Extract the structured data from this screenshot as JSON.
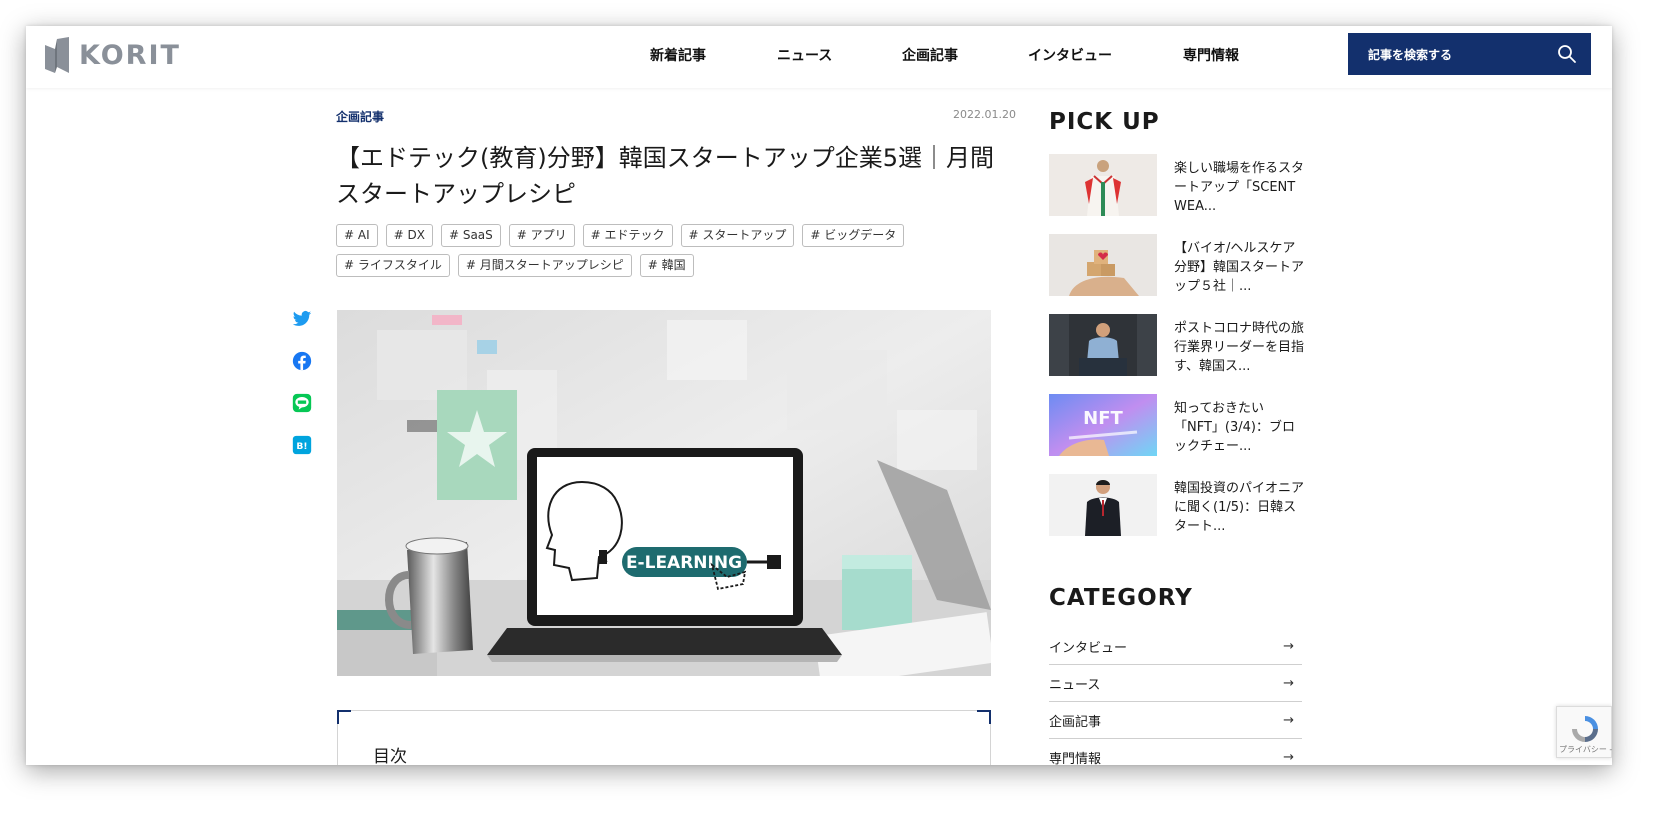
{
  "header": {
    "logo_text": "KORIT",
    "nav": [
      "新着記事",
      "ニュース",
      "企画記事",
      "インタビュー",
      "専門情報"
    ],
    "search_label": "記事を検索する"
  },
  "article": {
    "category": "企画記事",
    "date": "2022.01.20",
    "title": "【エドテック(教育)分野】韓国スタートアップ企業5選｜月間スタートアップレシピ",
    "tags": [
      "# AI",
      "# DX",
      "# SaaS",
      "# アプリ",
      "# エドテック",
      "# スタートアップ",
      "# ビッグデータ",
      "# ライフスタイル",
      "# 月間スタートアップレシピ",
      "# 韓国"
    ],
    "hero_image_text": "E-LEARNING",
    "toc_title": "目次"
  },
  "share_icons": [
    "twitter-icon",
    "facebook-icon",
    "line-icon",
    "hatena-bookmark-icon"
  ],
  "sidebar": {
    "pickup_heading": "PICK UP",
    "pickup": [
      {
        "text": "楽しい職場を作るスタートアップ「SCENT WEA..."
      },
      {
        "text": "【バイオ/ヘルスケア分野】韓国スタートアップ５社｜..."
      },
      {
        "text": "ポストコロナ時代の旅行業界リーダーを目指す、韓国ス..."
      },
      {
        "text": "知っておきたい「NFT」(3/4)：ブロックチェー...",
        "image_text": "NFT"
      },
      {
        "text": "韓国投資のパイオニアに聞く(1/5)：日韓スタート..."
      }
    ],
    "category_heading": "CATEGORY",
    "categories": [
      "インタビュー",
      "ニュース",
      "企画記事",
      "専門情報"
    ],
    "arrow": "→"
  },
  "recaptcha": {
    "text": "プライバシー - 利用規約"
  },
  "colors": {
    "brand_navy": "#13306d",
    "logo_gray": "#8a9099",
    "accent_teal": "#1e6b6f"
  }
}
